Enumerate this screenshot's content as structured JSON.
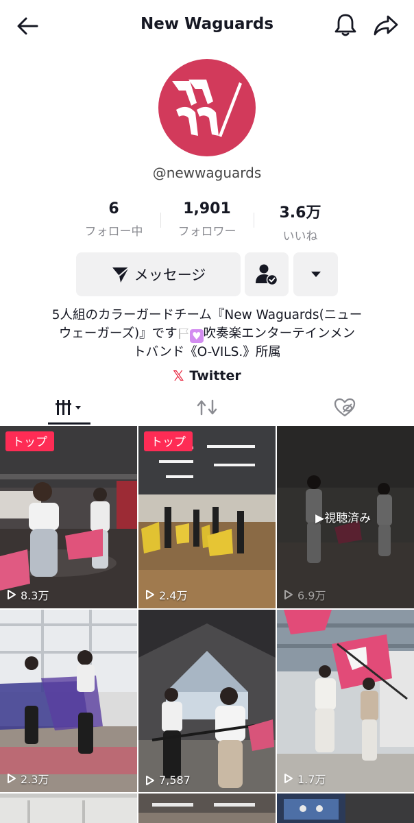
{
  "header": {
    "title": "New Waguards"
  },
  "profile": {
    "handle": "@newwaguards",
    "brand_color": "#d23a5b",
    "stats": [
      {
        "value": "6",
        "label": "フォロー中"
      },
      {
        "value": "1,901",
        "label": "フォロワー"
      },
      {
        "value": "3.6万",
        "label": "いいね"
      }
    ],
    "message_label": "メッセージ",
    "bio": {
      "line1": "5人組のカラーガードチーム『New Waguards(ニュー",
      "line2a": "ウェーガーズ)』です",
      "line2b": "吹奏楽エンターテインメン",
      "line3": "トバンド《O-VILS.》所属"
    },
    "link_label": "Twitter",
    "link_icon": "x-logo"
  },
  "tabs": [
    "videos-grid-icon",
    "repost-icon",
    "liked-hidden-icon"
  ],
  "videos": [
    {
      "badge": "トップ",
      "views": "8.3万"
    },
    {
      "badge": "トップ",
      "views": "2.4万"
    },
    {
      "overlay": "視聴済み",
      "views": "6.9万"
    },
    {
      "views": "2.3万"
    },
    {
      "views": "7,587"
    },
    {
      "views": "1.7万"
    }
  ],
  "colors": {
    "badge_red": "#fe2c55",
    "x_red": "#e8253f"
  }
}
